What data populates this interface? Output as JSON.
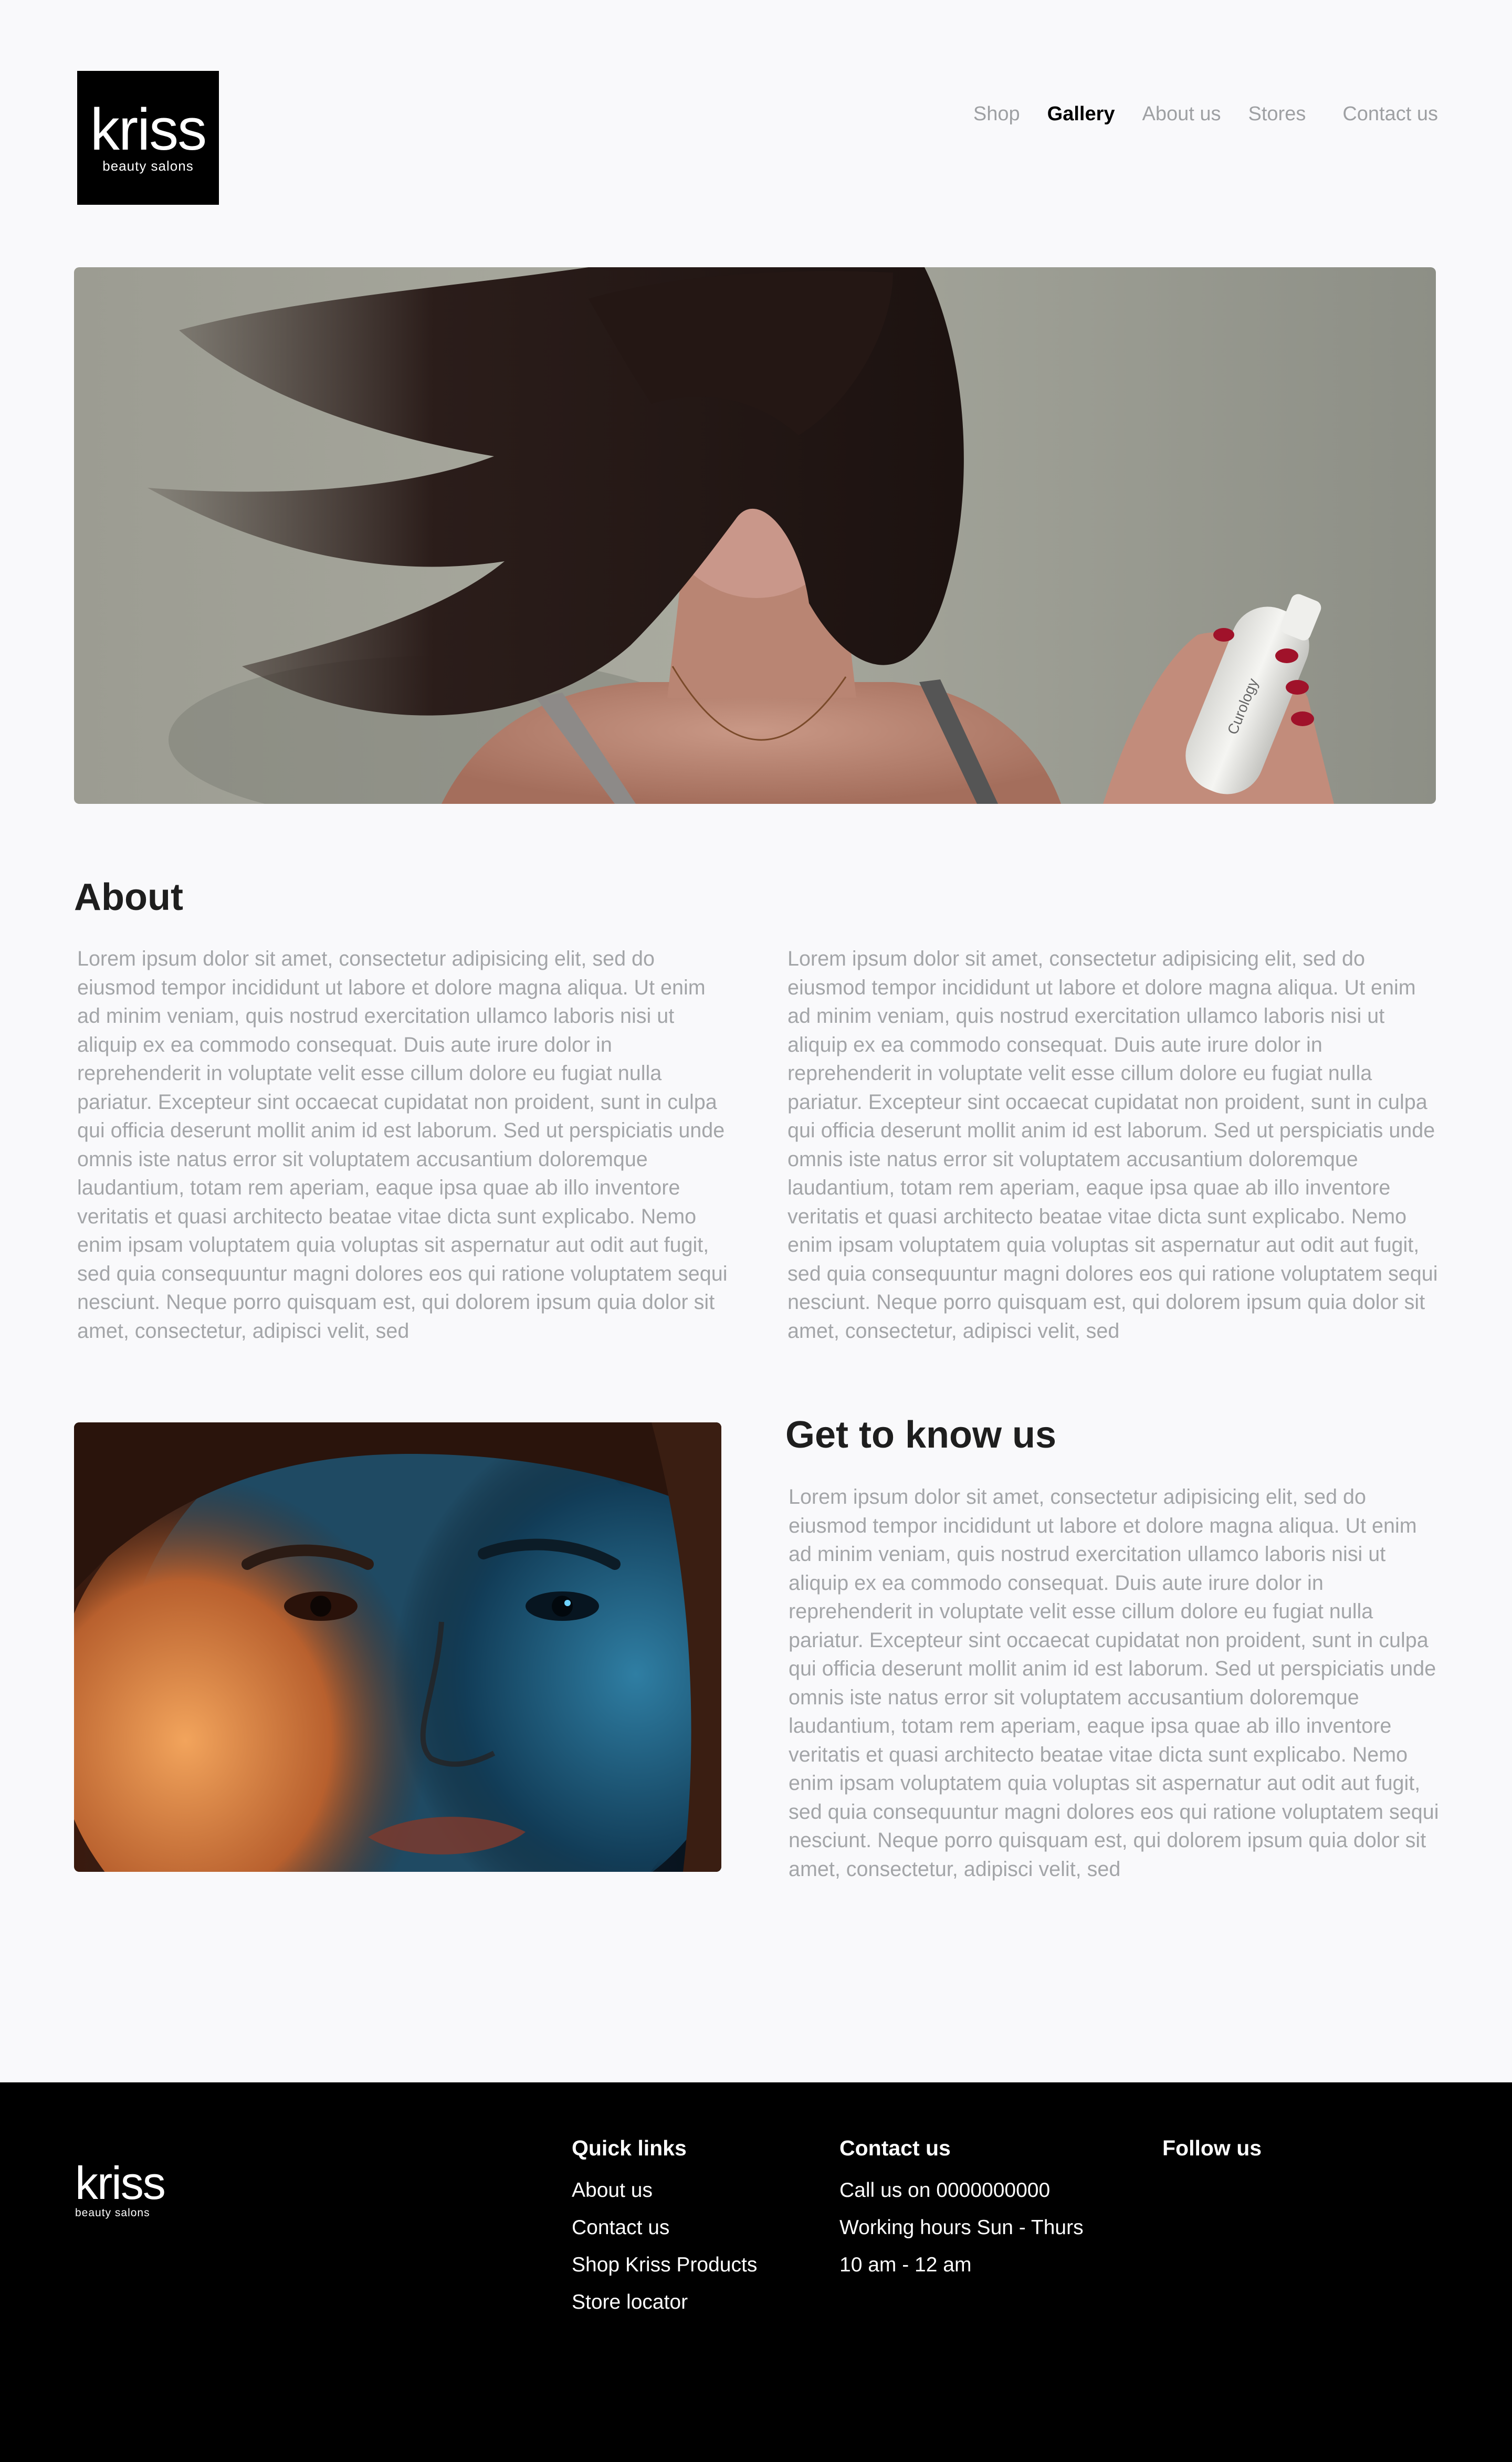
{
  "header": {
    "logo_word": "kriss",
    "logo_sub": "beauty salons",
    "nav": [
      {
        "label": "Shop",
        "active": false
      },
      {
        "label": "Gallery",
        "active": true
      },
      {
        "label": "About us",
        "active": false
      },
      {
        "label": "Stores",
        "active": false
      },
      {
        "label": "Contact us",
        "active": false
      }
    ]
  },
  "hero": {
    "bottle_text": "Curology"
  },
  "about": {
    "title": "About",
    "paragraph_1": "Lorem ipsum dolor sit amet, consectetur adipisicing elit, sed do eiusmod tempor incididunt ut labore et dolore magna aliqua. Ut enim ad minim veniam, quis nostrud exercitation ullamco laboris nisi ut aliquip ex ea commodo consequat. Duis aute irure dolor in reprehenderit in voluptate velit esse cillum dolore eu fugiat nulla pariatur. Excepteur sint occaecat cupidatat non proident, sunt in culpa qui officia deserunt mollit anim id est laborum. Sed ut perspiciatis unde omnis iste natus error sit voluptatem accusantium doloremque laudantium, totam rem aperiam, eaque ipsa quae ab illo inventore veritatis et quasi architecto beatae vitae dicta sunt explicabo. Nemo enim ipsam voluptatem quia voluptas sit aspernatur aut odit aut fugit, sed quia consequuntur magni dolores eos qui ratione voluptatem sequi nesciunt. Neque porro quisquam est, qui dolorem ipsum quia dolor sit amet, consectetur, adipisci velit, sed",
    "paragraph_2": "Lorem ipsum dolor sit amet, consectetur adipisicing elit, sed do eiusmod tempor incididunt ut labore et dolore magna aliqua. Ut enim ad minim veniam, quis nostrud exercitation ullamco laboris nisi ut aliquip ex ea commodo consequat. Duis aute irure dolor in reprehenderit in voluptate velit esse cillum dolore eu fugiat nulla pariatur. Excepteur sint occaecat cupidatat non proident, sunt in culpa qui officia deserunt mollit anim id est laborum. Sed ut perspiciatis unde omnis iste natus error sit voluptatem accusantium doloremque laudantium, totam rem aperiam, eaque ipsa quae ab illo inventore veritatis et quasi architecto beatae vitae dicta sunt explicabo. Nemo enim ipsam voluptatem quia voluptas sit aspernatur aut odit aut fugit, sed quia consequuntur magni dolores eos qui ratione voluptatem sequi nesciunt. Neque porro quisquam est, qui dolorem ipsum quia dolor sit amet, consectetur, adipisci velit, sed"
  },
  "know_us": {
    "title": "Get to know us",
    "paragraph": "Lorem ipsum dolor sit amet, consectetur adipisicing elit, sed do eiusmod tempor incididunt ut labore et dolore magna aliqua. Ut enim ad minim veniam, quis nostrud exercitation ullamco laboris nisi ut aliquip ex ea commodo consequat. Duis aute irure dolor in reprehenderit in voluptate velit esse cillum dolore eu fugiat nulla pariatur. Excepteur sint occaecat cupidatat non proident, sunt in culpa qui officia deserunt mollit anim id est laborum. Sed ut perspiciatis unde omnis iste natus error sit voluptatem accusantium doloremque laudantium, totam rem aperiam, eaque ipsa quae ab illo inventore veritatis et quasi architecto beatae vitae dicta sunt explicabo. Nemo enim ipsam voluptatem quia voluptas sit aspernatur aut odit aut fugit, sed quia consequuntur magni dolores eos qui ratione voluptatem sequi nesciunt. Neque porro quisquam est, qui dolorem ipsum quia dolor sit amet, consectetur, adipisci velit, sed"
  },
  "footer": {
    "logo_word": "kriss",
    "logo_sub": "beauty salons",
    "quick_links": {
      "heading": "Quick links",
      "items": [
        "About us",
        "Contact us",
        "Shop Kriss Products",
        "Store locator"
      ]
    },
    "contact": {
      "heading": "Contact us",
      "items": [
        "Call us on 0000000000",
        "Working hours Sun - Thurs",
        "10 am - 12 am"
      ]
    },
    "follow": {
      "heading": "Follow us"
    }
  },
  "colors": {
    "background": "#f9f9fb",
    "text_dark": "#1e1e1e",
    "text_muted": "#a3a5a8",
    "nav_inactive": "#9ea0a3",
    "footer_bg": "#000000"
  }
}
